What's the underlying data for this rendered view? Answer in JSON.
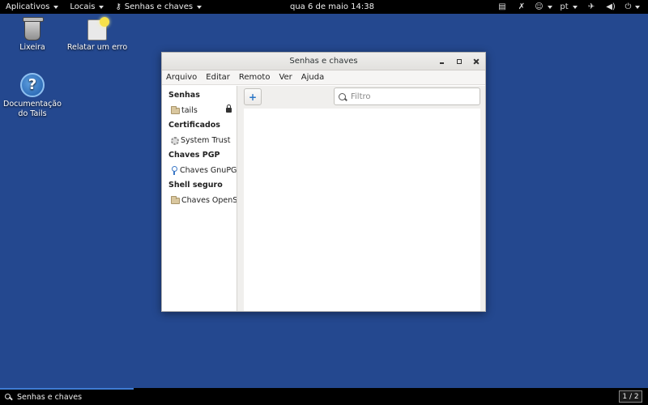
{
  "topbar": {
    "applications": "Aplicativos",
    "places": "Locais",
    "active_app": "Senhas e chaves",
    "clock": "qua 6 de maio  14:38",
    "language": "pt",
    "tray_icons": [
      "clipboard-icon",
      "network-icon",
      "accessibility-icon",
      "airplane-mode-icon",
      "volume-icon",
      "power-icon"
    ]
  },
  "desktop": {
    "icons": [
      {
        "label": "Lixeira",
        "icon": "trash-icon"
      },
      {
        "label": "Relatar um erro",
        "icon": "bug-report-icon"
      },
      {
        "label": "Documentação do Tails",
        "icon": "help-icon"
      }
    ]
  },
  "window": {
    "title": "Senhas e chaves",
    "menu": [
      "Arquivo",
      "Editar",
      "Remoto",
      "Ver",
      "Ajuda"
    ],
    "sidebar": {
      "sections": [
        {
          "heading": "Senhas",
          "items": [
            {
              "label": "tails",
              "icon": "folder-icon",
              "locked": true
            }
          ]
        },
        {
          "heading": "Certificados",
          "items": [
            {
              "label": "System Trust",
              "icon": "certificate-icon"
            }
          ]
        },
        {
          "heading": "Chaves PGP",
          "items": [
            {
              "label": "Chaves GnuPG",
              "icon": "key-icon"
            }
          ]
        },
        {
          "heading": "Shell seguro",
          "items": [
            {
              "label": "Chaves OpenS...",
              "icon": "folder-icon"
            }
          ]
        }
      ]
    },
    "toolbar": {
      "add_label": "+",
      "filter_placeholder": "Filtro",
      "filter_value": ""
    }
  },
  "taskbar": {
    "task_label": "Senhas e chaves",
    "workspace": "1 / 2"
  },
  "colors": {
    "desktop_bg": "#24488f",
    "accent": "#2a76c6"
  }
}
